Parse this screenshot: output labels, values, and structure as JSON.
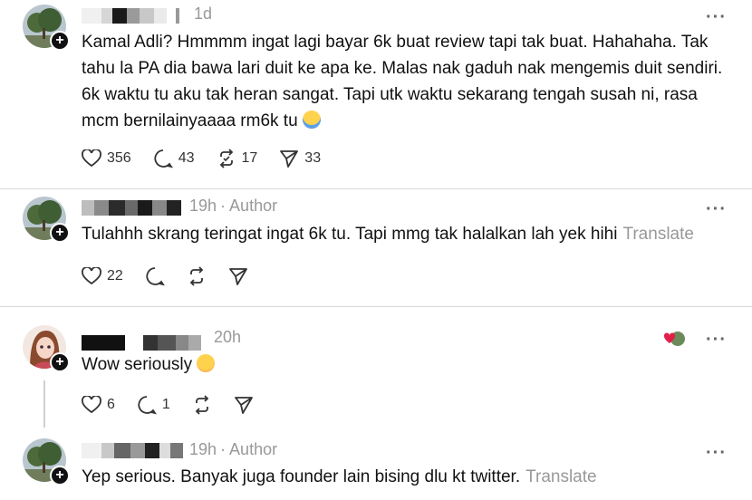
{
  "posts": [
    {
      "time": "1d",
      "author_tag": "",
      "text": "Kamal Adli? Hmmmm ingat lagi bayar 6k buat review tapi tak buat. Hahahaha. Tak tahu la PA dia bawa lari duit ke apa ke. Malas nak gaduh nak mengemis duit sendiri. 6k waktu tu aku tak heran sangat. Tapi utk waktu sekarang tengah susah ni, rasa mcm bernilainyaaaa rm6k tu",
      "translate": "",
      "likes": "356",
      "replies": "43",
      "reposts": "17",
      "shares": "33"
    },
    {
      "time": "19h",
      "author_tag": "Author",
      "text": "Tulahhh skrang teringat ingat 6k tu. Tapi mmg tak halalkan lah yek hihi",
      "translate": "Translate",
      "likes": "22",
      "replies": "",
      "reposts": "",
      "shares": ""
    },
    {
      "time": "20h",
      "author_tag": "",
      "text": "Wow seriously",
      "translate": "",
      "likes": "6",
      "replies": "1",
      "reposts": "",
      "shares": ""
    },
    {
      "time": "19h",
      "author_tag": "Author",
      "text": "Yep serious. Banyak juga founder lain bising dlu kt twitter.",
      "translate": "Translate",
      "likes": "",
      "replies": "",
      "reposts": "",
      "shares": ""
    }
  ],
  "symbols": {
    "separator": "·",
    "more": "···",
    "plus": "+"
  },
  "colors": {
    "muted": "#999999",
    "divider": "#d9d9d9",
    "text": "#111111"
  },
  "icons": [
    "heart-icon",
    "comment-icon",
    "repost-icon",
    "share-icon",
    "more-icon",
    "follow-plus-icon"
  ]
}
